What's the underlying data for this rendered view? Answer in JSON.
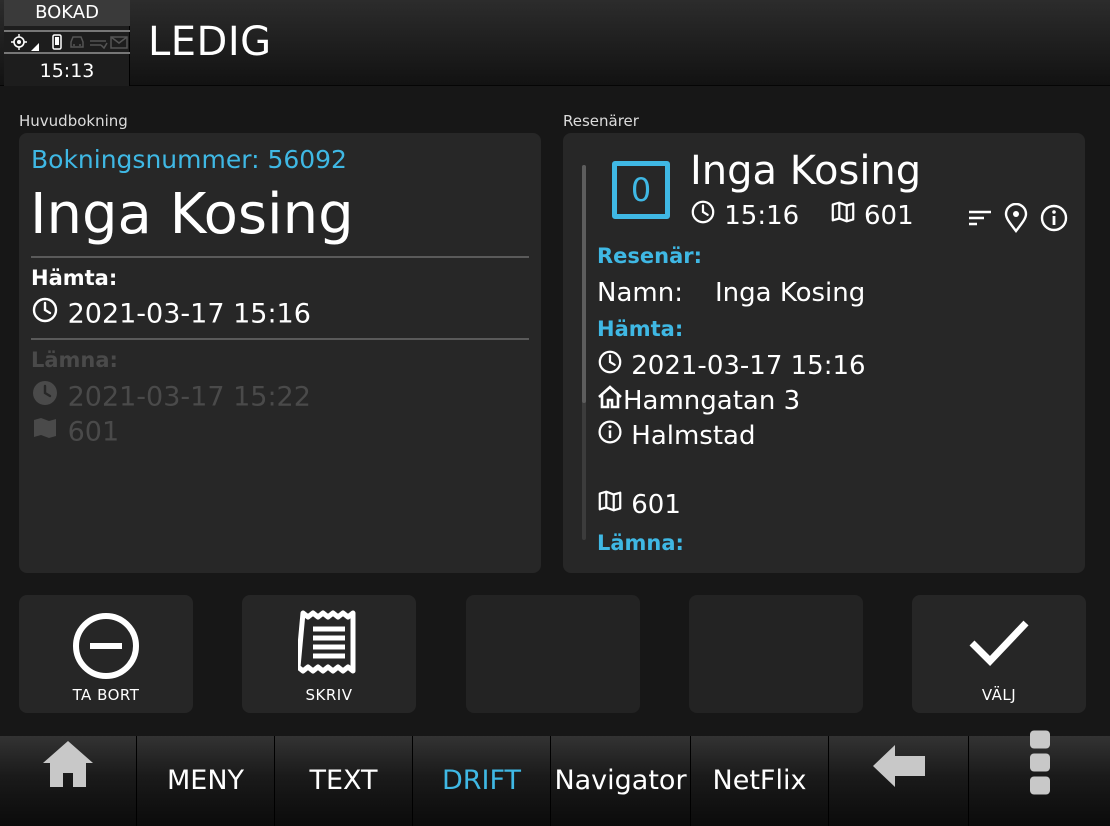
{
  "status": {
    "state_label": "BOKAD",
    "time": "15:13",
    "icons": [
      "location-icon",
      "signal-icon",
      "phone-icon",
      "taxi-icon",
      "signal-bars-icon",
      "mail-icon"
    ]
  },
  "header": {
    "title": "LEDIG"
  },
  "main_booking": {
    "section_label": "Huvudbokning",
    "booking_number": "Bokningsnummer: 56092",
    "name": "Inga Kosing",
    "pickup_label": "Hämta:",
    "pickup_time": "2021-03-17 15:16",
    "dropoff_label": "Lämna:",
    "dropoff_time": "2021-03-17 15:22",
    "dropoff_area": "601"
  },
  "passengers": {
    "section_label": "Resenärer",
    "badge_number": "0",
    "name": "Inga Kosing",
    "time": "15:16",
    "area": "601",
    "passenger_label": "Resenär:",
    "namn_key": "Namn:",
    "namn_value": "Inga Kosing",
    "pickup_label": "Hämta:",
    "pickup_time": "2021-03-17 15:16",
    "address": "Hamngatan 3",
    "city": "Halmstad",
    "pickup_area": "601",
    "dropoff_label": "Lämna:"
  },
  "actions": {
    "remove_label": "TA BORT",
    "print_label": "SKRIV",
    "select_label": "VÄLJ"
  },
  "nav": {
    "menu": "MENY",
    "text": "TEXT",
    "drift": "DRIFT",
    "navigator": "Navigator",
    "netflix": "NetFlix"
  },
  "colors": {
    "accent": "#3fb8e4",
    "panel": "#272727",
    "background": "#171717"
  }
}
